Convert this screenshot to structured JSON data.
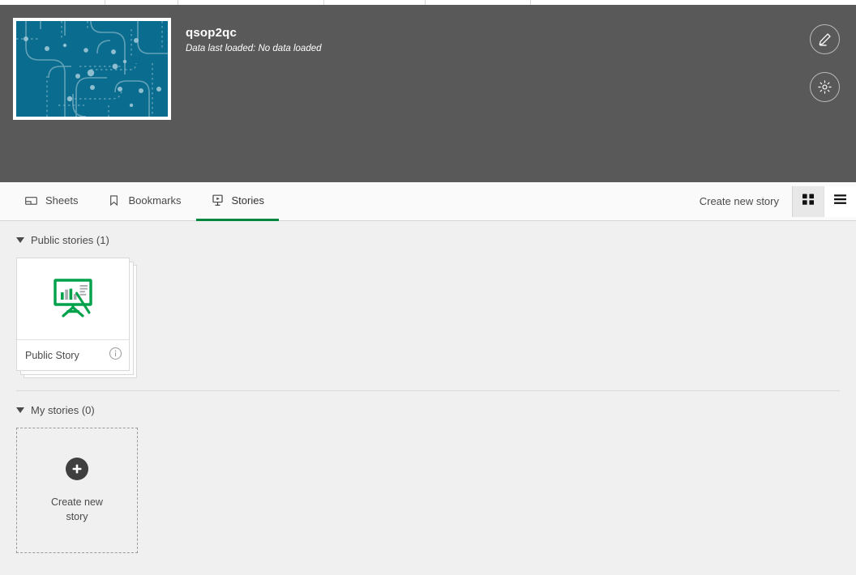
{
  "header": {
    "app_title": "qsop2qc",
    "data_status": "Data last loaded: No data loaded",
    "edit_button_title": "Edit",
    "settings_button_title": "App options",
    "thumbnail_bg_color": "#0a6c8e",
    "background_color": "#595959"
  },
  "tabs": [
    {
      "label": "Sheets",
      "icon": "sheet-icon",
      "active": false
    },
    {
      "label": "Bookmarks",
      "icon": "bookmark-icon",
      "active": false
    },
    {
      "label": "Stories",
      "icon": "story-icon",
      "active": true
    }
  ],
  "toolbar": {
    "create_new_story_label": "Create new story",
    "grid_view_title": "Grid view",
    "list_view_title": "List view",
    "active_view": "grid",
    "accent_color": "#00873d"
  },
  "sections": [
    {
      "title": "Public stories (1)",
      "expanded": true,
      "items": [
        {
          "name": "Public Story",
          "icon": "story-easel-icon",
          "info_title": "Show details",
          "stacked": true
        }
      ]
    },
    {
      "title": "My stories (0)",
      "expanded": true,
      "items": []
    }
  ],
  "create_card": {
    "line1": "Create new",
    "line2": "story",
    "plus_icon": "plus-icon"
  }
}
